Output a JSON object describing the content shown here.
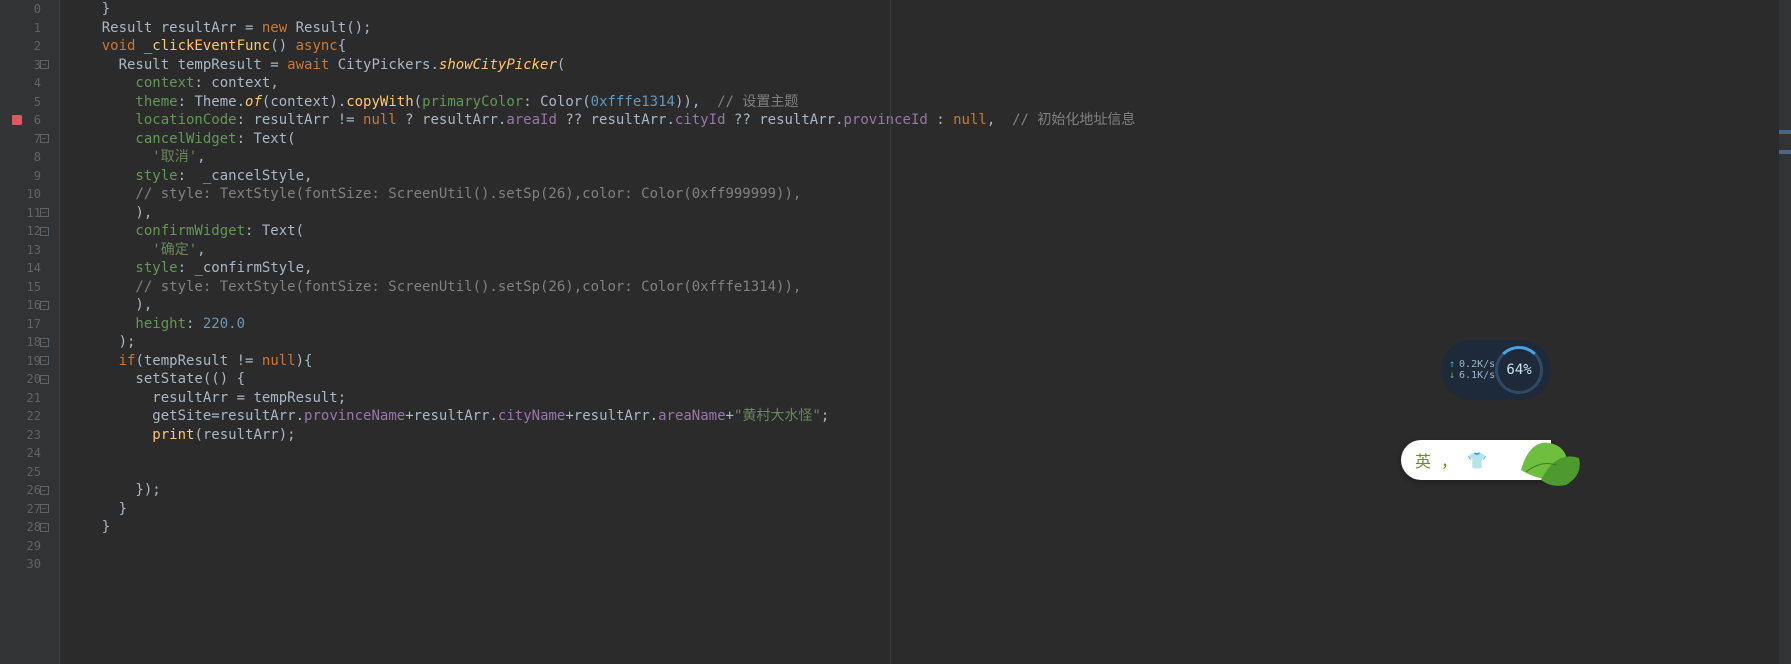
{
  "editor": {
    "start_line": 0,
    "breakpoint_line": 6,
    "lines": [
      {
        "folds": [],
        "tokens": [
          [
            "paren",
            "    }"
          ]
        ]
      },
      {
        "folds": [],
        "tokens": [
          [
            "type",
            "    Result "
          ],
          [
            "id",
            "resultArr"
          ],
          [
            "op",
            " = "
          ],
          [
            "kw",
            "new"
          ],
          [
            "type",
            " Result"
          ],
          [
            "paren",
            "();"
          ]
        ]
      },
      {
        "folds": [],
        "tokens": [
          [
            "kw",
            "    void "
          ],
          [
            "method",
            "_clickEventFunc"
          ],
          [
            "paren",
            "() "
          ],
          [
            "kw",
            "async"
          ],
          [
            "paren",
            "{"
          ]
        ]
      },
      {
        "folds": [
          "open"
        ],
        "tokens": [
          [
            "type",
            "      Result "
          ],
          [
            "id",
            "tempResult"
          ],
          [
            "op",
            " = "
          ],
          [
            "kw",
            "await "
          ],
          [
            "type",
            "CityPickers."
          ],
          [
            "method-italic",
            "showCityPicker"
          ],
          [
            "paren",
            "("
          ]
        ]
      },
      {
        "folds": [],
        "tokens": [
          [
            "param",
            "        context"
          ],
          [
            "op",
            ": "
          ],
          [
            "id",
            "context"
          ],
          [
            "paren",
            ","
          ]
        ]
      },
      {
        "folds": [],
        "tokens": [
          [
            "param",
            "        theme"
          ],
          [
            "op",
            ": "
          ],
          [
            "type",
            "Theme."
          ],
          [
            "method-italic",
            "of"
          ],
          [
            "paren",
            "("
          ],
          [
            "id",
            "context"
          ],
          [
            "paren",
            ")."
          ],
          [
            "method",
            "copyWith"
          ],
          [
            "paren",
            "("
          ],
          [
            "param",
            "primaryColor"
          ],
          [
            "op",
            ": "
          ],
          [
            "type",
            "Color"
          ],
          [
            "paren",
            "("
          ],
          [
            "num",
            "0xfffe1314"
          ],
          [
            "paren",
            ")),  "
          ],
          [
            "comment",
            "// 设置主题"
          ]
        ]
      },
      {
        "folds": [],
        "tokens": [
          [
            "param",
            "        locationCode"
          ],
          [
            "op",
            ": "
          ],
          [
            "id",
            "resultArr"
          ],
          [
            "op",
            " != "
          ],
          [
            "kw",
            "null"
          ],
          [
            "op",
            " ? "
          ],
          [
            "id",
            "resultArr"
          ],
          [
            "op",
            "."
          ],
          [
            "field",
            "areaId"
          ],
          [
            "op",
            " ?? "
          ],
          [
            "id",
            "resultArr"
          ],
          [
            "op",
            "."
          ],
          [
            "field",
            "cityId"
          ],
          [
            "op",
            " ?? "
          ],
          [
            "id",
            "resultArr"
          ],
          [
            "op",
            "."
          ],
          [
            "field",
            "provinceId"
          ],
          [
            "op",
            " : "
          ],
          [
            "kw",
            "null"
          ],
          [
            "paren",
            ",  "
          ],
          [
            "comment",
            "// 初始化地址信息"
          ]
        ]
      },
      {
        "folds": [
          "open"
        ],
        "tokens": [
          [
            "param",
            "        cancelWidget"
          ],
          [
            "op",
            ": "
          ],
          [
            "type",
            "Text"
          ],
          [
            "paren",
            "("
          ]
        ]
      },
      {
        "folds": [],
        "tokens": [
          [
            "str",
            "          '取消'"
          ],
          [
            "paren",
            ","
          ]
        ]
      },
      {
        "folds": [],
        "tokens": [
          [
            "param",
            "        style"
          ],
          [
            "op",
            ":  "
          ],
          [
            "id",
            "_cancelStyle"
          ],
          [
            "paren",
            ","
          ]
        ]
      },
      {
        "folds": [],
        "tokens": [
          [
            "comment",
            "        // style: TextStyle(fontSize: ScreenUtil().setSp(26),color: Color(0xff999999)),"
          ]
        ]
      },
      {
        "folds": [
          "close"
        ],
        "tokens": [
          [
            "paren",
            "        ),"
          ]
        ]
      },
      {
        "folds": [
          "open"
        ],
        "tokens": [
          [
            "param",
            "        confirmWidget"
          ],
          [
            "op",
            ": "
          ],
          [
            "type",
            "Text"
          ],
          [
            "paren",
            "("
          ]
        ]
      },
      {
        "folds": [],
        "tokens": [
          [
            "str",
            "          '确定'"
          ],
          [
            "paren",
            ","
          ]
        ]
      },
      {
        "folds": [],
        "tokens": [
          [
            "param",
            "        style"
          ],
          [
            "op",
            ": "
          ],
          [
            "id",
            "_confirmStyle"
          ],
          [
            "paren",
            ","
          ]
        ]
      },
      {
        "folds": [],
        "tokens": [
          [
            "comment",
            "        // style: TextStyle(fontSize: ScreenUtil().setSp(26),color: Color(0xfffe1314)),"
          ]
        ]
      },
      {
        "folds": [
          "close"
        ],
        "tokens": [
          [
            "paren",
            "        ),"
          ]
        ]
      },
      {
        "folds": [],
        "tokens": [
          [
            "param",
            "        height"
          ],
          [
            "op",
            ": "
          ],
          [
            "num",
            "220.0"
          ]
        ]
      },
      {
        "folds": [
          "close"
        ],
        "tokens": [
          [
            "paren",
            "      );"
          ]
        ]
      },
      {
        "folds": [
          "open"
        ],
        "tokens": [
          [
            "kw",
            "      if"
          ],
          [
            "paren",
            "("
          ],
          [
            "id",
            "tempResult"
          ],
          [
            "op",
            " != "
          ],
          [
            "kw",
            "null"
          ],
          [
            "paren",
            ")"
          ],
          [
            "paren",
            "{"
          ]
        ]
      },
      {
        "folds": [
          "open"
        ],
        "tokens": [
          [
            "id",
            "        setState"
          ],
          [
            "paren",
            "(() {"
          ]
        ]
      },
      {
        "folds": [],
        "tokens": [
          [
            "id",
            "          resultArr"
          ],
          [
            "op",
            " = "
          ],
          [
            "id",
            "tempResult"
          ],
          [
            "paren",
            ";"
          ]
        ]
      },
      {
        "folds": [],
        "tokens": [
          [
            "id",
            "          getSite"
          ],
          [
            "op",
            "="
          ],
          [
            "id",
            "resultArr"
          ],
          [
            "op",
            "."
          ],
          [
            "field",
            "provinceName"
          ],
          [
            "op",
            "+"
          ],
          [
            "id",
            "resultArr"
          ],
          [
            "op",
            "."
          ],
          [
            "field",
            "cityName"
          ],
          [
            "op",
            "+"
          ],
          [
            "id",
            "resultArr"
          ],
          [
            "op",
            "."
          ],
          [
            "field",
            "areaName"
          ],
          [
            "op",
            "+"
          ],
          [
            "str",
            "\"黄村大水怪\""
          ],
          [
            "paren",
            ";"
          ]
        ]
      },
      {
        "folds": [],
        "tokens": [
          [
            "method",
            "          print"
          ],
          [
            "paren",
            "("
          ],
          [
            "id",
            "resultArr"
          ],
          [
            "paren",
            ");"
          ]
        ]
      },
      {
        "folds": [],
        "tokens": [
          [
            "id",
            ""
          ]
        ]
      },
      {
        "folds": [],
        "tokens": [
          [
            "id",
            ""
          ]
        ]
      },
      {
        "folds": [
          "close"
        ],
        "tokens": [
          [
            "paren",
            "        });"
          ]
        ]
      },
      {
        "folds": [
          "close"
        ],
        "tokens": [
          [
            "paren",
            "      }"
          ]
        ]
      },
      {
        "folds": [
          "close"
        ],
        "tokens": [
          [
            "paren",
            "    }"
          ]
        ]
      },
      {
        "folds": [],
        "tokens": [
          [
            "id",
            ""
          ]
        ]
      },
      {
        "folds": [],
        "tokens": [
          [
            "id",
            ""
          ]
        ]
      }
    ]
  },
  "netmon": {
    "up": "0.2K/s",
    "down": "6.1K/s",
    "percent": "64%"
  },
  "ime": {
    "lang": "英",
    "sep": "，",
    "icon_name": "shirt-icon"
  }
}
